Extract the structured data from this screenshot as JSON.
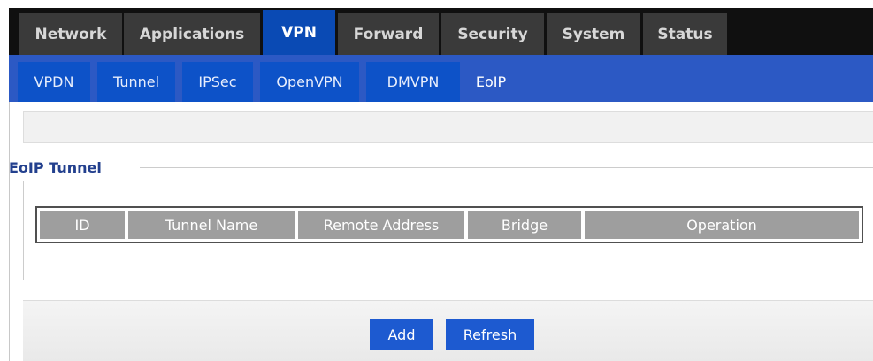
{
  "top_tabs": [
    {
      "label": "Network"
    },
    {
      "label": "Applications"
    },
    {
      "label": "VPN"
    },
    {
      "label": "Forward"
    },
    {
      "label": "Security"
    },
    {
      "label": "System"
    },
    {
      "label": "Status"
    }
  ],
  "active_top_tab": "VPN",
  "sub_tabs": [
    {
      "label": "VPDN"
    },
    {
      "label": "Tunnel"
    },
    {
      "label": "IPSec"
    },
    {
      "label": "OpenVPN"
    },
    {
      "label": "DMVPN"
    },
    {
      "label": "EoIP"
    }
  ],
  "active_sub_tab": "EoIP",
  "section": {
    "legend": "EoIP Tunnel"
  },
  "table": {
    "columns": [
      "ID",
      "Tunnel Name",
      "Remote Address",
      "Bridge",
      "Operation"
    ],
    "rows": []
  },
  "buttons": {
    "add_label": "Add",
    "refresh_label": "Refresh"
  },
  "colors": {
    "top_bar": "#101010",
    "top_tab": "#3a3a3a",
    "top_tab_active": "#0a4ab4",
    "sub_bar": "#2c59c4",
    "sub_tab": "#0d52c8",
    "legend": "#23408e",
    "table_header": "#9e9e9e",
    "button": "#1d5ad0"
  }
}
